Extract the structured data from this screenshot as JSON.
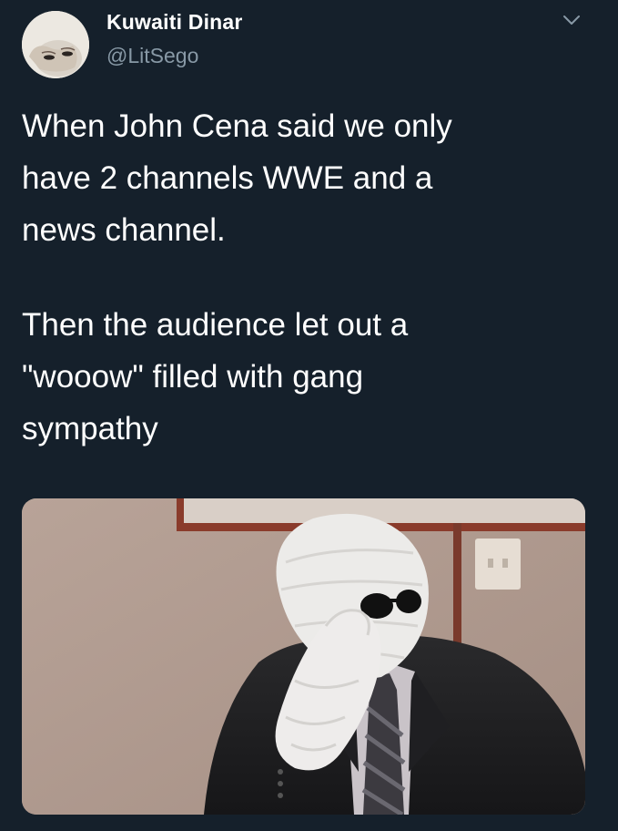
{
  "author": {
    "display_name": "Kuwaiti Dinar",
    "handle": "@LitSego"
  },
  "tweet": {
    "paragraphs": [
      "When John Cena said we only\nhave 2 channels WWE and a\nnews channel.",
      "Then the audience let out a\n\"wooow\" filled with gang\nsympathy"
    ]
  },
  "icons": {
    "menu": "chevron-down-icon"
  },
  "colors": {
    "background": "#15202b",
    "primary_text": "#ffffff",
    "secondary_text": "#8899a6"
  }
}
